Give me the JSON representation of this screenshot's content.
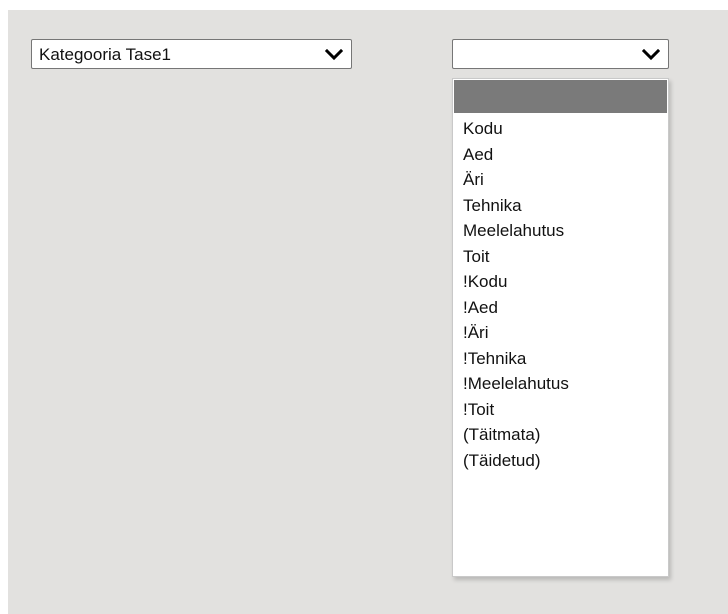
{
  "selects": {
    "category_level1": {
      "value": "Kategooria Tase1"
    },
    "category_value": {
      "value": "",
      "options": [
        "",
        "Kodu",
        "Aed",
        "Äri",
        "Tehnika",
        "Meelelahutus",
        "Toit",
        "!Kodu",
        "!Aed",
        "!Äri",
        "!Tehnika",
        "!Meelelahutus",
        "!Toit",
        "(Täitmata)",
        "(Täidetud)"
      ],
      "highlighted_index": 0
    }
  },
  "colors": {
    "panel_background": "#e2e1df",
    "highlight": "#7a7a7a",
    "border": "#767676"
  },
  "icons": {
    "dropdown_arrow": "chevron-down-icon"
  }
}
